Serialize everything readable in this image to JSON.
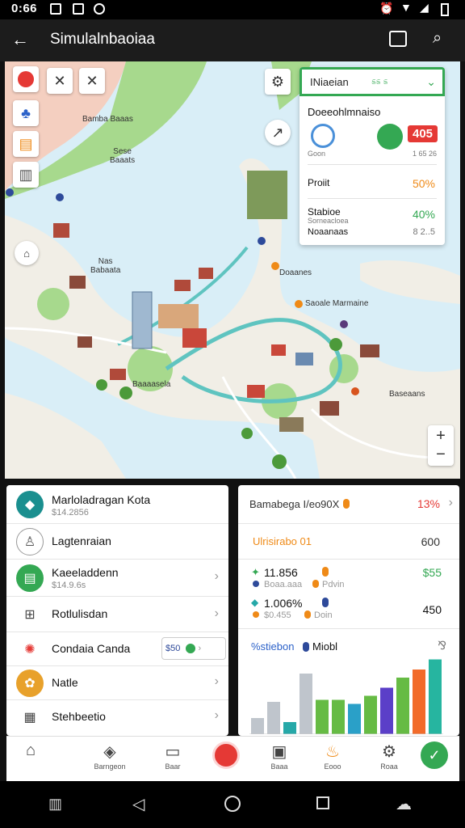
{
  "status_bar": {
    "time": "0:66"
  },
  "app_bar": {
    "title": "Simulalnbaoiaa"
  },
  "map": {
    "labels": [
      "Bamba\nBaaas",
      "Sese\nBaaats",
      "Nas\nBabaata",
      "Doaanes",
      "Saoale Marmaine",
      "Baaaasela",
      "Baseaans"
    ],
    "zoom_in": "+",
    "zoom_out": "−"
  },
  "stats_card": {
    "header": "INiaeian",
    "header_tag": "ಽಽ ಽ",
    "title": "Doeeohlmnaiso",
    "badge_sub": "Goon",
    "badge_value": "405",
    "badge_caption": "1 65 26",
    "rows": [
      {
        "label": "Proiit",
        "value": "50%"
      },
      {
        "label": "Stabioe",
        "value": "40%"
      },
      {
        "label": "Noaanaas",
        "value": "8 2..5"
      }
    ],
    "row_sub": "Sorneacloea"
  },
  "left_list": {
    "items": [
      {
        "title": "Marloladragan Kota",
        "sub": "$14.2856"
      },
      {
        "title": "Lagtenraian",
        "sub": ""
      },
      {
        "title": "Kaeeladdenn",
        "sub": "$14.9.6s"
      },
      {
        "title": "Rotlulisdan",
        "sub": ""
      },
      {
        "title": "Condaia Canda",
        "sub": "",
        "chip": "$50"
      },
      {
        "title": "Natle",
        "sub": ""
      },
      {
        "title": "Stehbeetio",
        "sub": ""
      }
    ]
  },
  "right_panel": {
    "row1": {
      "label": "Bamabega I/eo90X",
      "value": "13%"
    },
    "row2": {
      "label": "Ulrisirabo 01",
      "value": "600"
    },
    "row3": {
      "a_value": "11.856",
      "a_sub": "Boaa.aaa",
      "a_sub2": "Pdvin",
      "a_side": "$55",
      "b_value": "1.006%",
      "b_sub": "$0.455",
      "b_sub2": "Doin",
      "b_side": "450"
    },
    "chart_title": "%stiebon",
    "chart_title2": "Miobl",
    "chart_menu": "⅋"
  },
  "chart_data": {
    "type": "bar",
    "values": [
      8,
      16,
      6,
      30,
      17,
      17,
      15,
      19,
      23,
      28,
      32,
      37
    ],
    "colors": [
      "#bfc5cc",
      "#bfc5cc",
      "#26a8a8",
      "#bfc5cc",
      "#66bb44",
      "#66bb44",
      "#2aa0c8",
      "#66bb44",
      "#5b3fc8",
      "#66bb44",
      "#f26b2a",
      "#26b5a0"
    ],
    "ylim": [
      0,
      40
    ]
  },
  "bottom_nav": {
    "items": [
      {
        "icon": "home-icon",
        "label": ""
      },
      {
        "icon": "compass-icon",
        "label": "Barngeon"
      },
      {
        "icon": "car-icon",
        "label": "Baar"
      },
      {
        "icon": "center-icon",
        "label": ""
      },
      {
        "icon": "box-icon",
        "label": "Baaa"
      },
      {
        "icon": "fire-icon",
        "label": "Eooo"
      },
      {
        "icon": "gear-icon",
        "label": "Roaa"
      },
      {
        "icon": "check-icon",
        "label": ""
      }
    ]
  },
  "colors": {
    "accent_green": "#34a853",
    "red": "#e53935",
    "orange": "#ef8a17",
    "teal": "#26a8a8"
  }
}
